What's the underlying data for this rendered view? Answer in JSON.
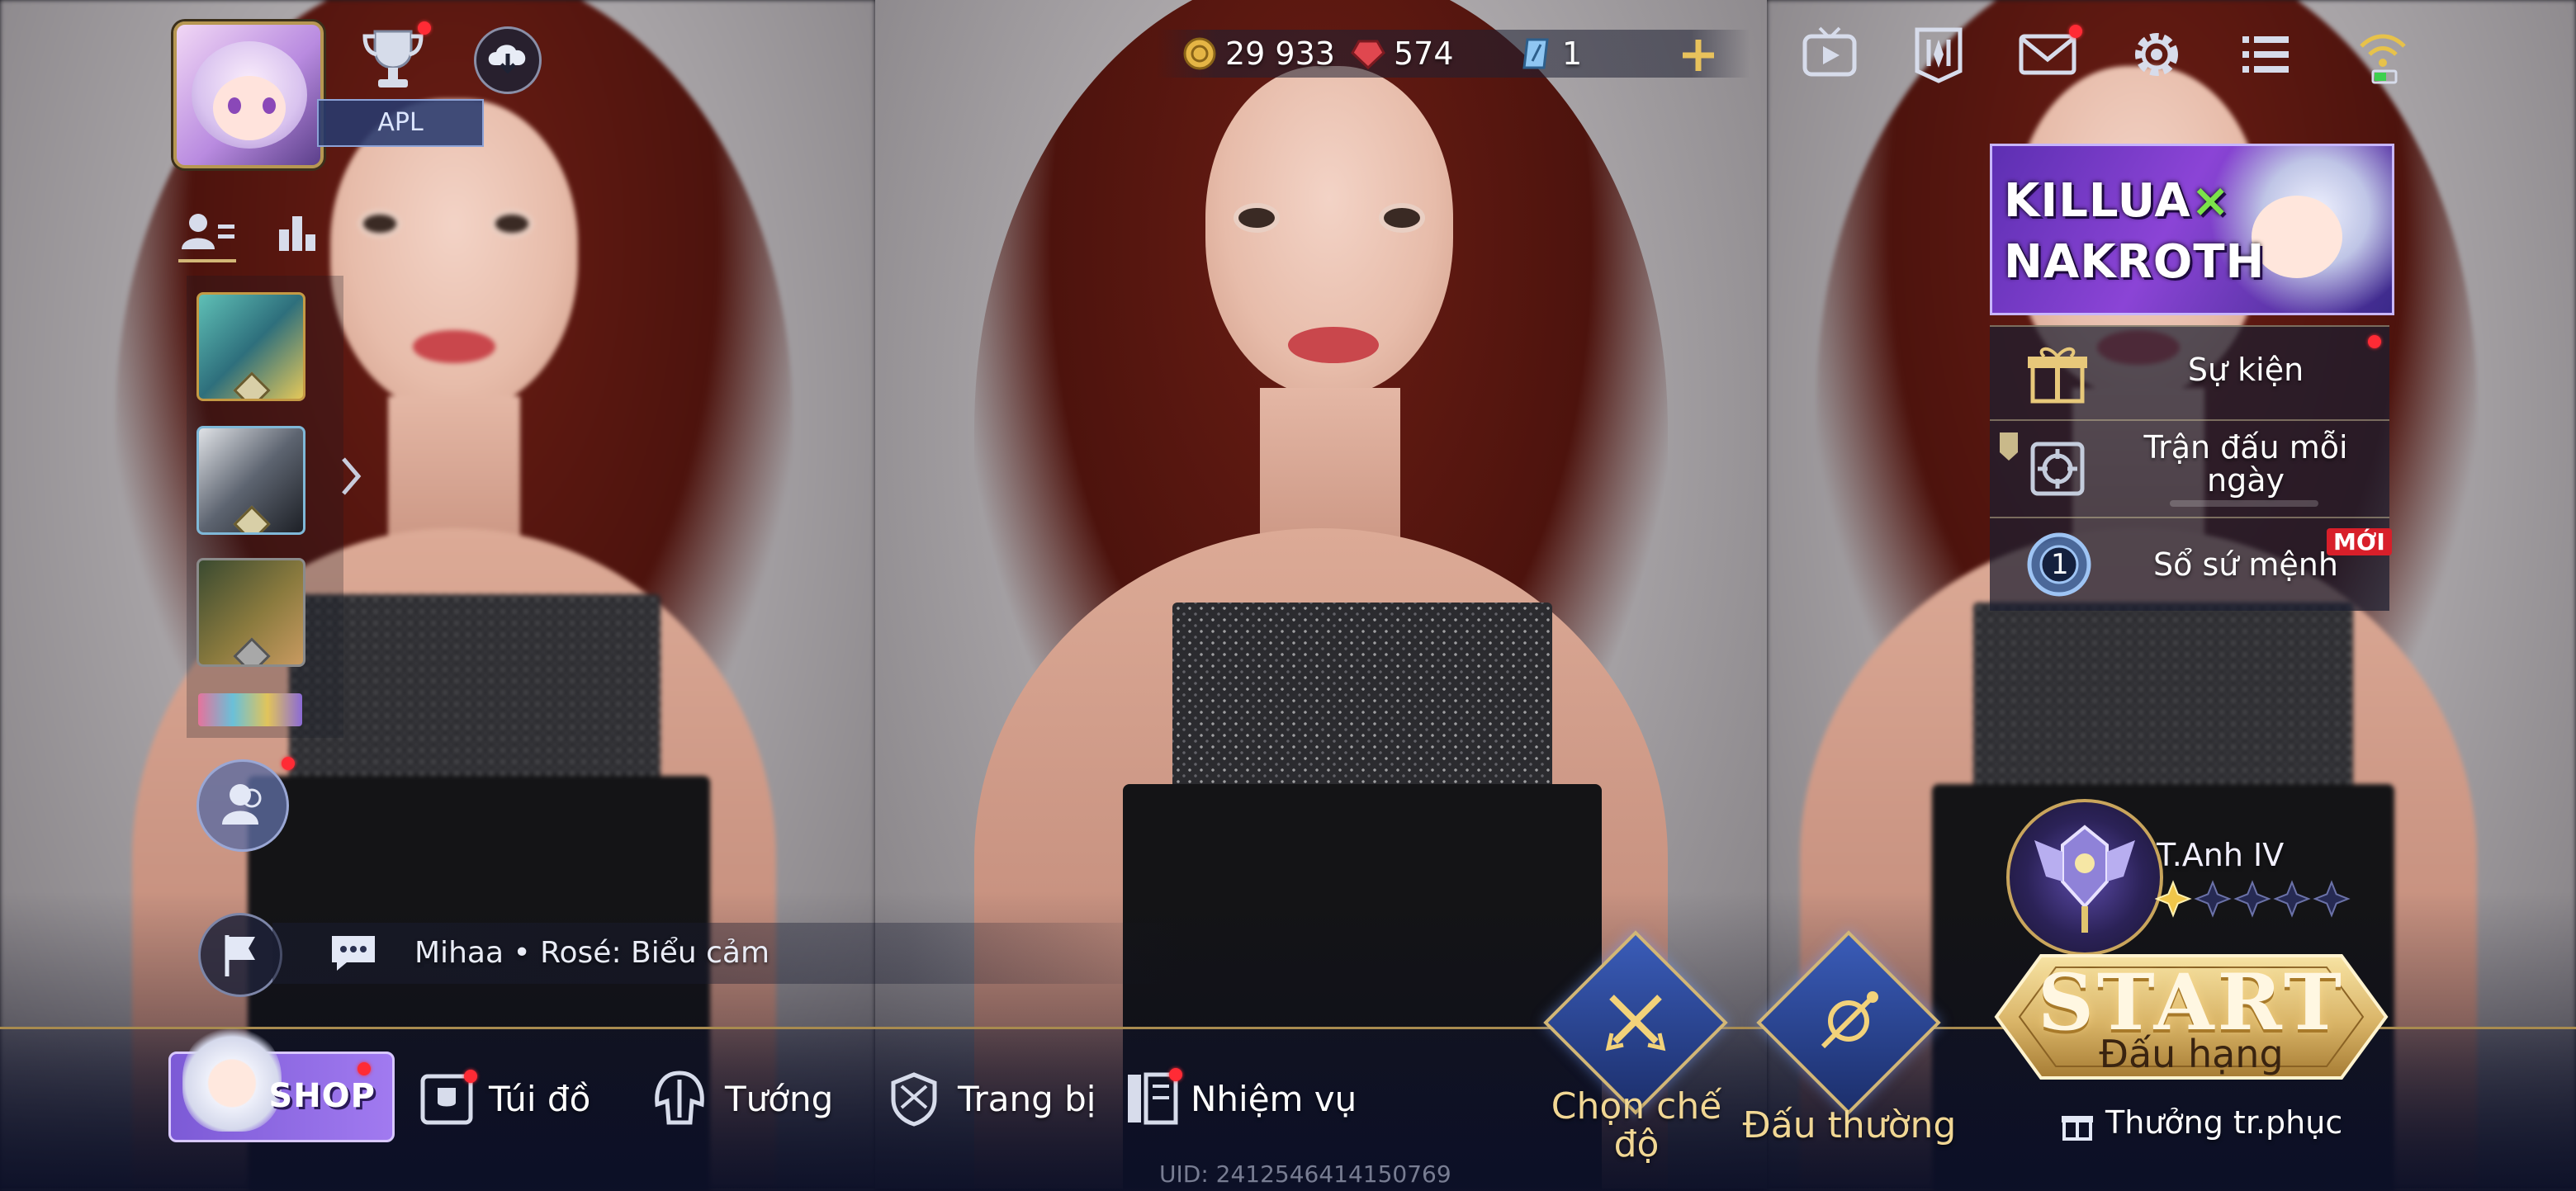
{
  "top_left": {
    "tag_label": "APL"
  },
  "currencies": [
    {
      "icon": "gold-coin-icon",
      "value": "29 933"
    },
    {
      "icon": "red-gem-icon",
      "value": "574"
    },
    {
      "icon": "voucher-icon",
      "value": "1"
    }
  ],
  "top_right_icons": [
    "replay-tv-icon",
    "guild-banner-icon",
    "mail-icon",
    "settings-gear-icon",
    "menu-list-icon",
    "wifi-signal-icon"
  ],
  "banner": {
    "line1": "KILLUA",
    "line1_mark": "×",
    "line2": "NAKROTH"
  },
  "events": [
    {
      "label": "Sự kiện",
      "icon": "event-gift-icon"
    },
    {
      "label": "Trận đấu mỗi ngày",
      "icon": "daily-match-icon"
    },
    {
      "label": "Sổ sứ mệnh",
      "icon": "mission-book-icon",
      "badge": "MỚI",
      "level": "1"
    }
  ],
  "chat": {
    "text": "Mihaa • Rosé: Biểu cảm"
  },
  "rank": {
    "name": "T.Anh IV",
    "stars_filled": 1,
    "stars_total": 5
  },
  "bottom_nav": {
    "shop": "SHOP",
    "items": [
      {
        "label": "Túi đồ",
        "icon": "bag-icon"
      },
      {
        "label": "Tướng",
        "icon": "hero-helmet-icon"
      },
      {
        "label": "Trang bị",
        "icon": "equipment-icon"
      },
      {
        "label": "Nhiệm vụ",
        "icon": "quest-icon"
      }
    ],
    "mode_select": "Chọn chế độ",
    "normal_match": "Đấu thường",
    "start": "START",
    "start_sub": "Đấu hạng",
    "reward": "Thưởng tr.phục"
  },
  "uid": "UID: 2412546414150769",
  "colors": {
    "accent_gold": "#d2b777",
    "notification_red": "#ff2b35",
    "rank_star_gold": "#f0c64a"
  }
}
